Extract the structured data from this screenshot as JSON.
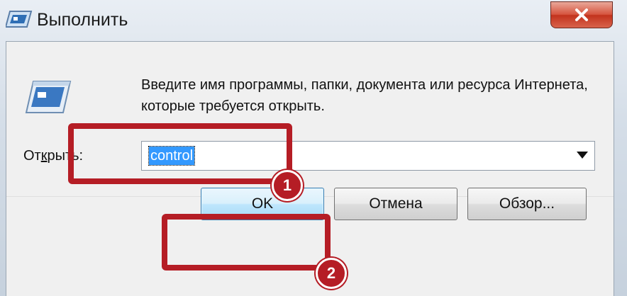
{
  "window": {
    "title": "Выполнить",
    "icons": {
      "app": "run-app-icon",
      "close": "close-icon",
      "run": "run-program-icon",
      "dropdown": "chevron-down-icon"
    }
  },
  "dialog": {
    "description": "Введите имя программы, папки, документа или ресурса Интернета, которые требуется открыть.",
    "open_label_pre": "От",
    "open_label_underlined": "к",
    "open_label_post": "рыть:",
    "open_value": "control"
  },
  "buttons": {
    "ok": "OK",
    "cancel": "Отмена",
    "browse": "Обзор..."
  },
  "annotations": {
    "step1": "1",
    "step2": "2",
    "color": "#b51d25"
  }
}
